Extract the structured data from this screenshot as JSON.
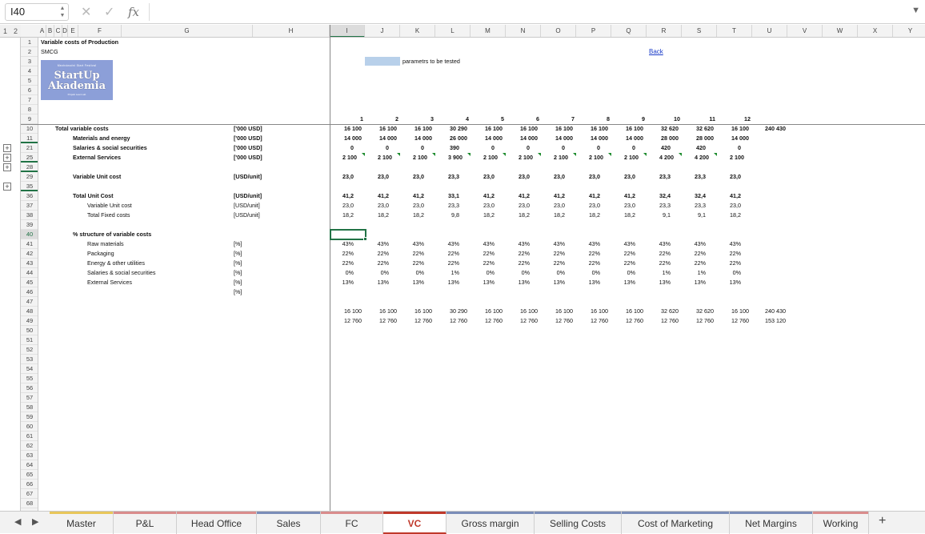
{
  "formula_bar": {
    "name_box": "I40",
    "fx": "fx"
  },
  "outline": {
    "levels": [
      "1",
      "2"
    ]
  },
  "columns": [
    "A",
    "B",
    "C",
    "D",
    "E",
    "F",
    "G",
    "H",
    "I",
    "J",
    "K",
    "L",
    "M",
    "N",
    "O",
    "P",
    "Q",
    "R",
    "S",
    "T",
    "U",
    "V",
    "W",
    "X",
    "Y"
  ],
  "rows": [
    "1",
    "2",
    "3",
    "4",
    "5",
    "6",
    "7",
    "8",
    "9",
    "10",
    "11",
    "21",
    "25",
    "28",
    "29",
    "35",
    "36",
    "37",
    "38",
    "39",
    "40",
    "41",
    "42",
    "43",
    "44",
    "45",
    "46",
    "47",
    "48",
    "49",
    "50",
    "51",
    "52",
    "53",
    "54",
    "55",
    "56",
    "57",
    "58",
    "59",
    "60",
    "61",
    "62",
    "63",
    "64",
    "65",
    "66",
    "67",
    "68"
  ],
  "sheet": {
    "title": "Variable costs of Production",
    "subtitle": "SMCG",
    "legend_text": "parametrs to be tested",
    "back_link": "Back",
    "logo": {
      "top": "Mezinárodní Start Festival",
      "line1": "StartUp",
      "line2": "Akademia",
      "bottom": "Projekt Lean Lab"
    },
    "periods": [
      "1",
      "2",
      "3",
      "4",
      "5",
      "6",
      "7",
      "8",
      "9",
      "10",
      "11",
      "12"
    ],
    "blocks": [
      {
        "label": "Total variable costs",
        "unit": "['000 USD]",
        "values": [
          "16 100",
          "16 100",
          "16 100",
          "30 290",
          "16 100",
          "16 100",
          "16 100",
          "16 100",
          "16 100",
          "32 620",
          "32 620",
          "16 100"
        ],
        "total": "240 430",
        "bold": true
      },
      {
        "label": "Materials and energy",
        "unit": "['000 USD]",
        "values": [
          "14 000",
          "14 000",
          "14 000",
          "26 000",
          "14 000",
          "14 000",
          "14 000",
          "14 000",
          "14 000",
          "28 000",
          "28 000",
          "14 000"
        ],
        "total": "",
        "bold": true
      },
      {
        "label": "Salaries & social securities",
        "unit": "['000 USD]",
        "values": [
          "0",
          "0",
          "0",
          "390",
          "0",
          "0",
          "0",
          "0",
          "0",
          "420",
          "420",
          "0"
        ],
        "total": "",
        "bold": true
      },
      {
        "label": "External Services",
        "unit": "['000 USD]",
        "values": [
          "2 100",
          "2 100",
          "2 100",
          "3 900",
          "2 100",
          "2 100",
          "2 100",
          "2 100",
          "2 100",
          "4 200",
          "4 200",
          "2 100"
        ],
        "total": "",
        "bold": true
      },
      {
        "label": "Variable Unit cost",
        "unit": "[USD/unit]",
        "values": [
          "23,0",
          "23,0",
          "23,0",
          "23,3",
          "23,0",
          "23,0",
          "23,0",
          "23,0",
          "23,0",
          "23,3",
          "23,3",
          "23,0"
        ],
        "total": "",
        "bold": true
      },
      {
        "label": "Total Unit Cost",
        "unit": "[USD/unit]",
        "values": [
          "41,2",
          "41,2",
          "41,2",
          "33,1",
          "41,2",
          "41,2",
          "41,2",
          "41,2",
          "41,2",
          "32,4",
          "32,4",
          "41,2"
        ],
        "total": "",
        "bold": true
      },
      {
        "label": "Variable Unit cost",
        "unit": "[USD/unit]",
        "values": [
          "23,0",
          "23,0",
          "23,0",
          "23,3",
          "23,0",
          "23,0",
          "23,0",
          "23,0",
          "23,0",
          "23,3",
          "23,3",
          "23,0"
        ],
        "total": "",
        "bold": false
      },
      {
        "label": "Total Fixed costs",
        "unit": "[USD/unit]",
        "values": [
          "18,2",
          "18,2",
          "18,2",
          "9,8",
          "18,2",
          "18,2",
          "18,2",
          "18,2",
          "18,2",
          "9,1",
          "9,1",
          "18,2"
        ],
        "total": "",
        "bold": false
      },
      {
        "label": "% structure of variable costs",
        "unit": "",
        "values": [],
        "total": "",
        "bold": true
      },
      {
        "label": "Raw materials",
        "unit": "[%]",
        "values": [
          "43%",
          "43%",
          "43%",
          "43%",
          "43%",
          "43%",
          "43%",
          "43%",
          "43%",
          "43%",
          "43%",
          "43%"
        ],
        "total": "",
        "bold": false
      },
      {
        "label": "Packaging",
        "unit": "[%]",
        "values": [
          "22%",
          "22%",
          "22%",
          "22%",
          "22%",
          "22%",
          "22%",
          "22%",
          "22%",
          "22%",
          "22%",
          "22%"
        ],
        "total": "",
        "bold": false
      },
      {
        "label": "Energy & other utilities",
        "unit": "[%]",
        "values": [
          "22%",
          "22%",
          "22%",
          "22%",
          "22%",
          "22%",
          "22%",
          "22%",
          "22%",
          "22%",
          "22%",
          "22%"
        ],
        "total": "",
        "bold": false
      },
      {
        "label": "Salaries & social securities",
        "unit": "[%]",
        "values": [
          "0%",
          "0%",
          "0%",
          "1%",
          "0%",
          "0%",
          "0%",
          "0%",
          "0%",
          "1%",
          "1%",
          "0%"
        ],
        "total": "",
        "bold": false
      },
      {
        "label": "External Services",
        "unit": "[%]",
        "values": [
          "13%",
          "13%",
          "13%",
          "13%",
          "13%",
          "13%",
          "13%",
          "13%",
          "13%",
          "13%",
          "13%",
          "13%"
        ],
        "total": "",
        "bold": false
      },
      {
        "label": "",
        "unit": "[%]",
        "values": [],
        "total": "",
        "bold": false
      },
      {
        "label": "",
        "unit": "",
        "values": [
          "16 100",
          "16 100",
          "16 100",
          "30 290",
          "16 100",
          "16 100",
          "16 100",
          "16 100",
          "16 100",
          "32 620",
          "32 620",
          "16 100"
        ],
        "total": "240 430",
        "bold": false
      },
      {
        "label": "",
        "unit": "",
        "values": [
          "12 760",
          "12 760",
          "12 760",
          "12 760",
          "12 760",
          "12 760",
          "12 760",
          "12 760",
          "12 760",
          "12 760",
          "12 760",
          "12 760"
        ],
        "total": "153 120",
        "bold": false
      }
    ]
  },
  "tabs": [
    {
      "label": "Master",
      "color": "#e8c65a"
    },
    {
      "label": "P&L",
      "color": "#d98c8c"
    },
    {
      "label": "Head Office",
      "color": "#d98c8c"
    },
    {
      "label": "Sales",
      "color": "#7a8db8"
    },
    {
      "label": "FC",
      "color": "#d98c8c"
    },
    {
      "label": "VC",
      "color": "#c0392b"
    },
    {
      "label": "Gross margin",
      "color": "#7a8db8"
    },
    {
      "label": "Selling Costs",
      "color": "#7a8db8"
    },
    {
      "label": "Cost of Marketing",
      "color": "#7a8db8"
    },
    {
      "label": "Net Margins",
      "color": "#7a8db8"
    },
    {
      "label": "Working",
      "color": "#d98c8c"
    }
  ],
  "add_sheet": "+"
}
